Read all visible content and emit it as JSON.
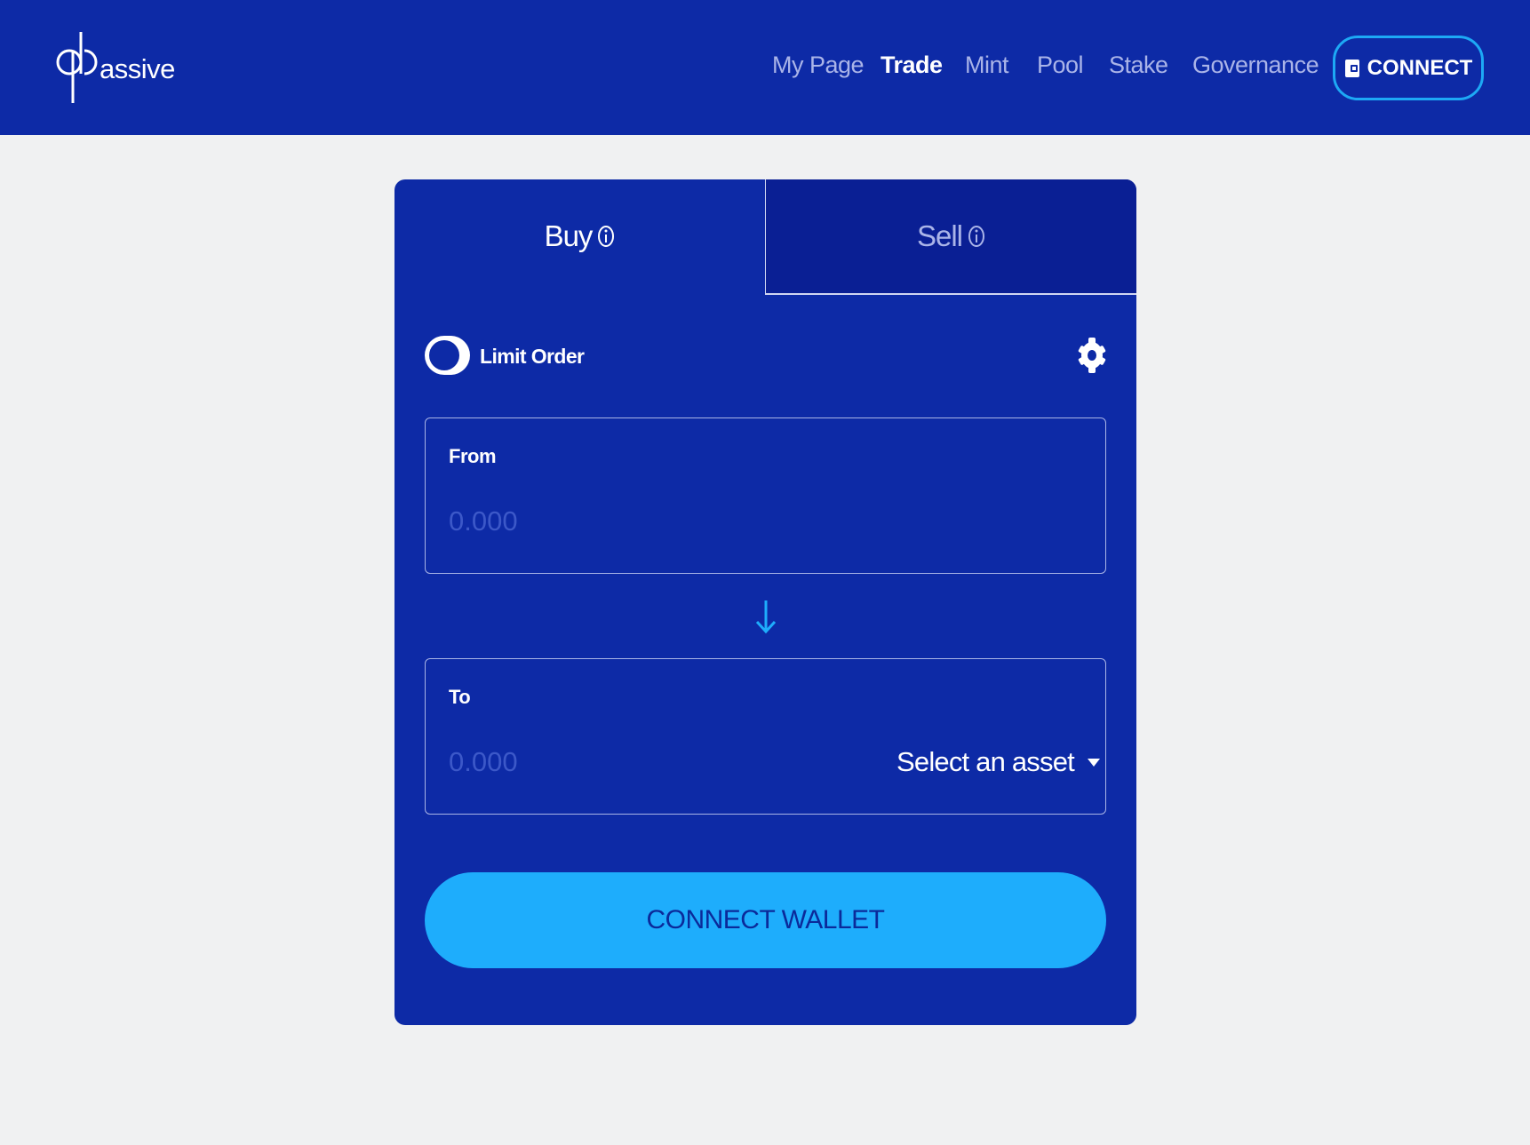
{
  "header": {
    "logo_text": "assive",
    "nav": [
      {
        "label": "My Page",
        "active": false
      },
      {
        "label": "Trade",
        "active": true
      },
      {
        "label": "Mint",
        "active": false
      },
      {
        "label": "Pool",
        "active": false
      },
      {
        "label": "Stake",
        "active": false
      },
      {
        "label": "Governance",
        "active": false
      }
    ],
    "connect_label": "CONNECT"
  },
  "trade": {
    "tabs": [
      {
        "label": "Buy",
        "active": true
      },
      {
        "label": "Sell",
        "active": false
      }
    ],
    "limit_order": {
      "label": "Limit Order",
      "enabled": false
    },
    "from": {
      "label": "From",
      "placeholder": "0.000",
      "value": ""
    },
    "to": {
      "label": "To",
      "placeholder": "0.000",
      "value": "",
      "asset_label": "Select an asset"
    },
    "connect_wallet_label": "CONNECT WALLET"
  },
  "icons": {
    "tab_info": "info-icon",
    "settings": "gear-icon",
    "swap_direction": "arrow-down-icon",
    "wallet": "wallet-icon",
    "dropdown": "caret-down-icon"
  },
  "colors": {
    "brand_blue": "#0d2aa6",
    "accent_cyan": "#1eadfc",
    "page_background": "#f0f1f2"
  }
}
